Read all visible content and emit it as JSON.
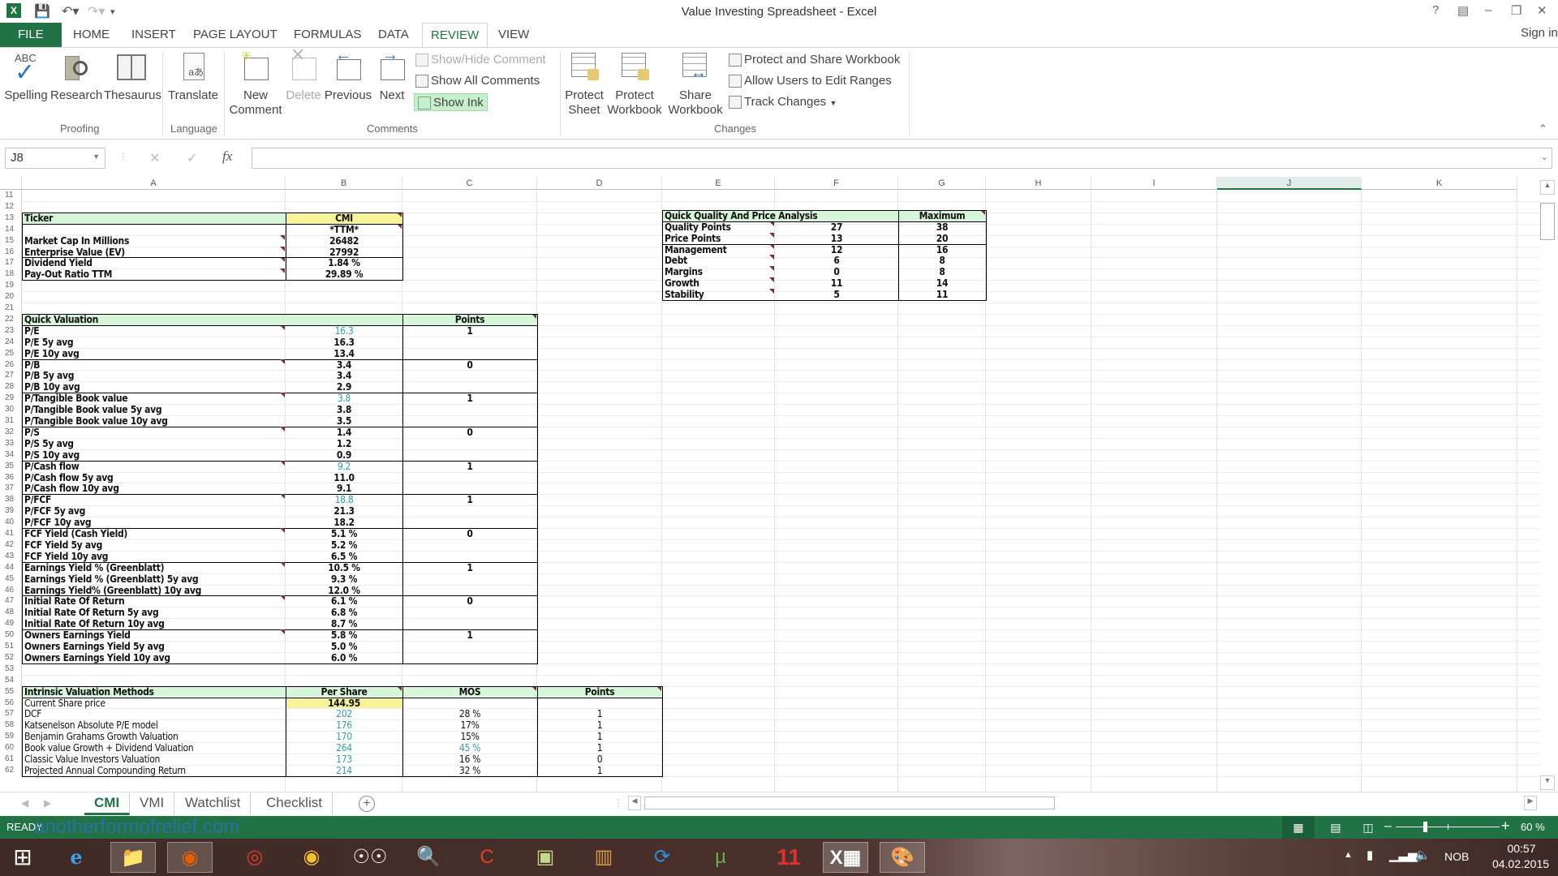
{
  "window": {
    "title": "Value Investing Spreadsheet - Excel",
    "help": "?",
    "sign_in": "Sign in"
  },
  "ribbon_tabs": [
    "FILE",
    "HOME",
    "INSERT",
    "PAGE LAYOUT",
    "FORMULAS",
    "DATA",
    "REVIEW",
    "VIEW"
  ],
  "active_tab": "REVIEW",
  "ribbon": {
    "proofing": {
      "label": "Proofing",
      "spelling": "Spelling",
      "research": "Research",
      "thesaurus": "Thesaurus",
      "abc": "ABC"
    },
    "language": {
      "label": "Language",
      "translate": "Translate"
    },
    "comments": {
      "label": "Comments",
      "new_comment_1": "New",
      "new_comment_2": "Comment",
      "delete": "Delete",
      "previous": "Previous",
      "next": "Next",
      "show_hide": "Show/Hide Comment",
      "show_all": "Show All Comments",
      "show_ink": "Show Ink"
    },
    "changes": {
      "label": "Changes",
      "protect_sheet_1": "Protect",
      "protect_sheet_2": "Sheet",
      "protect_wb_1": "Protect",
      "protect_wb_2": "Workbook",
      "share_wb_1": "Share",
      "share_wb_2": "Workbook",
      "protect_share": "Protect and Share Workbook",
      "allow_edit": "Allow Users to Edit Ranges",
      "track_changes": "Track Changes"
    }
  },
  "formula_bar": {
    "name_box": "J8",
    "fx": "fx",
    "cancel": "✕",
    "enter": "✓",
    "value": ""
  },
  "columns": [
    "A",
    "B",
    "C",
    "D",
    "E",
    "F",
    "G",
    "H",
    "I",
    "J",
    "K"
  ],
  "selected_column": "J",
  "row_numbers": [
    "11",
    "12",
    "13",
    "14",
    "15",
    "16",
    "17",
    "18",
    "19",
    "20",
    "21",
    "22",
    "23",
    "24",
    "25",
    "26",
    "27",
    "28",
    "29",
    "30",
    "31",
    "32",
    "33",
    "34",
    "35",
    "36",
    "37",
    "38",
    "39",
    "40",
    "41",
    "42",
    "43",
    "44",
    "45",
    "46",
    "47",
    "48",
    "49",
    "50",
    "51",
    "52",
    "53",
    "54",
    "55",
    "56",
    "57",
    "58",
    "59",
    "60",
    "61",
    "62"
  ],
  "ticker_table": {
    "header_label": "Ticker",
    "header_value": "CMI",
    "ttm": "*TTM*",
    "rows": [
      {
        "label": "Market Cap In Millions",
        "value": "26482"
      },
      {
        "label": "Enterprise Value (EV)",
        "value": "27992"
      },
      {
        "label": "Dividend Yield",
        "value": "1.84 %"
      },
      {
        "label": "Pay-Out Ratio TTM",
        "value": "29.89 %"
      }
    ]
  },
  "quick_valuation": {
    "header": "Quick Valuation",
    "points_header": "Points",
    "groups": [
      {
        "points": "1",
        "rows": [
          {
            "label": "P/E",
            "value": "16.3",
            "teal": true
          },
          {
            "label": "P/E 5y avg",
            "value": "16.3"
          },
          {
            "label": "P/E 10y avg",
            "value": "13.4"
          }
        ]
      },
      {
        "points": "0",
        "rows": [
          {
            "label": "P/B",
            "value": "3.4"
          },
          {
            "label": "P/B 5y avg",
            "value": "3.4"
          },
          {
            "label": "P/B 10y avg",
            "value": "2.9"
          }
        ]
      },
      {
        "points": "1",
        "rows": [
          {
            "label": "P/Tangible Book value",
            "value": "3.8",
            "teal": true
          },
          {
            "label": "P/Tangible Book value 5y avg",
            "value": "3.8"
          },
          {
            "label": "P/Tangible Book value 10y avg",
            "value": "3.5"
          }
        ]
      },
      {
        "points": "0",
        "rows": [
          {
            "label": "P/S",
            "value": "1.4"
          },
          {
            "label": "P/S 5y avg",
            "value": "1.2"
          },
          {
            "label": "P/S 10y avg",
            "value": "0.9"
          }
        ]
      },
      {
        "points": "1",
        "rows": [
          {
            "label": "P/Cash flow",
            "value": "9.2",
            "teal": true
          },
          {
            "label": "P/Cash flow 5y avg",
            "value": "11.0"
          },
          {
            "label": "P/Cash flow 10y avg",
            "value": "9.1"
          }
        ]
      },
      {
        "points": "1",
        "rows": [
          {
            "label": "P/FCF",
            "value": "18.8",
            "teal": true
          },
          {
            "label": "P/FCF 5y avg",
            "value": "21.3"
          },
          {
            "label": "P/FCF 10y avg",
            "value": "18.2"
          }
        ]
      },
      {
        "points": "0",
        "rows": [
          {
            "label": "FCF Yield (Cash Yield)",
            "value": "5.1 %"
          },
          {
            "label": "FCF Yield 5y avg",
            "value": "5.2 %"
          },
          {
            "label": "FCF Yield 10y avg",
            "value": "6.5 %"
          }
        ]
      },
      {
        "points": "1",
        "rows": [
          {
            "label": "Earnings Yield % (Greenblatt)",
            "value": "10.5 %"
          },
          {
            "label": "Earnings Yield % (Greenblatt) 5y avg",
            "value": "9.3 %"
          },
          {
            "label": "Earnings Yield% (Greenblatt) 10y avg",
            "value": "12.0 %"
          }
        ]
      },
      {
        "points": "0",
        "rows": [
          {
            "label": "Initial Rate Of Return",
            "value": "6.1 %"
          },
          {
            "label": "Initial Rate Of Return 5y avg",
            "value": "6.8 %"
          },
          {
            "label": "Initial Rate Of Return 10y avg",
            "value": "8.7 %"
          }
        ]
      },
      {
        "points": "1",
        "rows": [
          {
            "label": "Owners Earnings Yield",
            "value": "5.8 %"
          },
          {
            "label": "Owners Earnings Yield 5y avg",
            "value": "5.0 %"
          },
          {
            "label": "Owners Earnings Yield 10y avg",
            "value": "6.0 %"
          }
        ]
      }
    ]
  },
  "intrinsic": {
    "header": "Intrinsic Valuation Methods",
    "per_share": "Per Share",
    "mos": "MOS",
    "points": "Points",
    "current_price_label": "Current Share price",
    "current_price": "144.95",
    "rows": [
      {
        "label": "DCF",
        "value": "202",
        "mos": "28 %",
        "points": "1"
      },
      {
        "label": "Katsenelson Absolute P/E model",
        "value": "176",
        "mos": "17%",
        "points": "1"
      },
      {
        "label": "Benjamin Grahams Growth Valuation",
        "value": "170",
        "mos": "15%",
        "points": "1"
      },
      {
        "label": "Book value Growth + Dividend Valuation",
        "value": "264",
        "mos": "45 %",
        "mos_teal": true,
        "points": "1"
      },
      {
        "label": "Classic Value Investors Valuation",
        "value": "173",
        "mos": "16 %",
        "points": "0"
      },
      {
        "label": "Projected Annual Compounding Return",
        "value": "214",
        "mos": "32 %",
        "points": "1"
      }
    ]
  },
  "quality": {
    "header": "Quick Quality And Price Analysis",
    "max_header": "Maximum",
    "rows": [
      {
        "label": "Quality Points",
        "value": "27",
        "max": "38"
      },
      {
        "label": "Price Points",
        "value": "13",
        "max": "20"
      },
      {
        "label": "Management",
        "value": "12",
        "max": "16"
      },
      {
        "label": "Debt",
        "value": "6",
        "max": "8"
      },
      {
        "label": "Margins",
        "value": "0",
        "max": "8"
      },
      {
        "label": "Growth",
        "value": "11",
        "max": "14"
      },
      {
        "label": "Stability",
        "value": "5",
        "max": "11"
      }
    ]
  },
  "sheet_tabs": [
    "CMI",
    "VMI",
    "Watchlist",
    "Checklist"
  ],
  "active_sheet": "CMI",
  "status": {
    "text": "READY",
    "watermark": "anotherformofrelief.com",
    "zoom": "60 %",
    "zoom_percent": 60
  },
  "taskbar": {
    "apps": [
      "windows-start",
      "internet-explorer",
      "file-explorer",
      "firefox",
      "chrome",
      "fl-studio",
      "app-owl",
      "search-doc",
      "ccleaner",
      "notes",
      "chart-app",
      "filezilla",
      "utorrent",
      "app-11",
      "excel",
      "paint"
    ],
    "app11_label": "11",
    "tray_lang": "NOB",
    "time": "00:57",
    "date": "04.02.2015"
  },
  "colors": {
    "excel_green": "#217346",
    "header_green": "#d7f6d9",
    "ticker_yellow": "#f7f39a",
    "teal_value": "#3a9aa8",
    "show_ink_bg": "#c6efce"
  }
}
